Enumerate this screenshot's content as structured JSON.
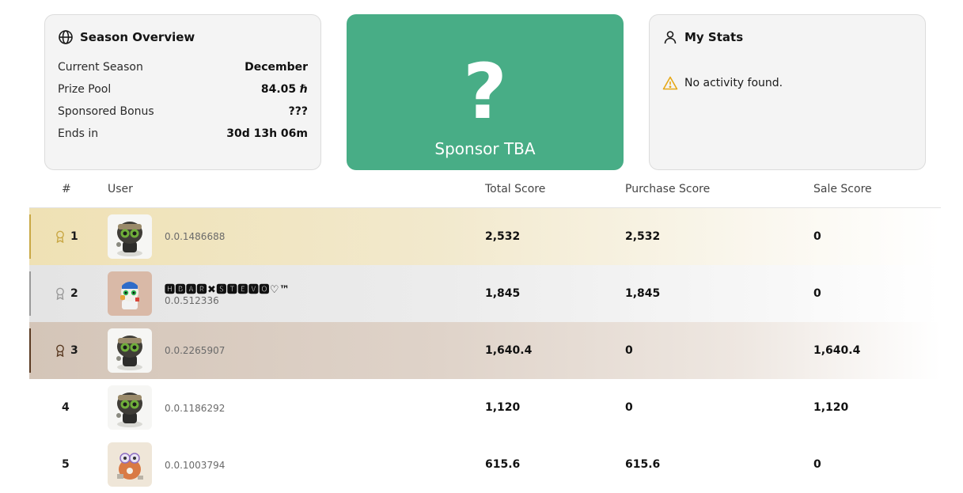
{
  "overview": {
    "title": "Season Overview",
    "icon": "globe-icon",
    "rows": [
      {
        "label": "Current Season",
        "value": "December"
      },
      {
        "label": "Prize Pool",
        "value": "84.05 ℏ"
      },
      {
        "label": "Sponsored Bonus",
        "value": "???"
      },
      {
        "label": "Ends in",
        "value": "30d 13h 06m"
      }
    ]
  },
  "sponsor": {
    "mark": "?",
    "text": "Sponsor TBA",
    "color": "#48ad86"
  },
  "mystats": {
    "title": "My Stats",
    "icon": "user-icon",
    "empty": "No activity found.",
    "warning_icon": "warning-icon",
    "warning_color": "#e6a817"
  },
  "table": {
    "headers": {
      "rank": "#",
      "user": "User",
      "total": "Total Score",
      "purchase": "Purchase Score",
      "sale": "Sale Score"
    },
    "rows": [
      {
        "rank": "1",
        "medal": "gold",
        "account": "0.0.1486688",
        "name": "",
        "total": "2,532",
        "purchase": "2,532",
        "sale": "0"
      },
      {
        "rank": "2",
        "medal": "silver",
        "account": "0.0.512336",
        "name": "🅷🅱🅰🆁✖🆂🆃🅴🆅🅾♡™",
        "total": "1,845",
        "purchase": "1,845",
        "sale": "0"
      },
      {
        "rank": "3",
        "medal": "bronze",
        "account": "0.0.2265907",
        "name": "",
        "total": "1,640.4",
        "purchase": "0",
        "sale": "1,640.4"
      },
      {
        "rank": "4",
        "medal": "",
        "account": "0.0.1186292",
        "name": "",
        "total": "1,120",
        "purchase": "0",
        "sale": "1,120"
      },
      {
        "rank": "5",
        "medal": "",
        "account": "0.0.1003794",
        "name": "",
        "total": "615.6",
        "purchase": "615.6",
        "sale": "0"
      }
    ]
  }
}
